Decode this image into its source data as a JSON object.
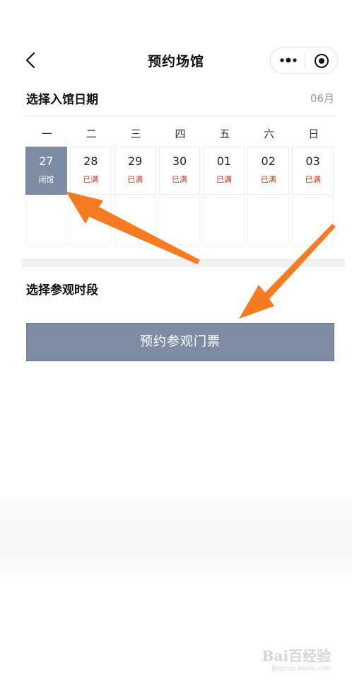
{
  "header": {
    "title": "预约场馆",
    "back_icon": "chevron-left-icon",
    "more_icon": "more-dots-icon",
    "close_icon": "target-close-icon"
  },
  "date_section": {
    "title": "选择入馆日期",
    "month": "06月",
    "weekdays": [
      "一",
      "二",
      "三",
      "四",
      "五",
      "六",
      "日"
    ],
    "days": [
      {
        "day": "27",
        "status": "闭馆",
        "state": "closed"
      },
      {
        "day": "28",
        "status": "已满",
        "state": "full"
      },
      {
        "day": "29",
        "status": "已满",
        "state": "full"
      },
      {
        "day": "30",
        "status": "已满",
        "state": "full"
      },
      {
        "day": "01",
        "status": "已满",
        "state": "full"
      },
      {
        "day": "02",
        "status": "已满",
        "state": "full"
      },
      {
        "day": "03",
        "status": "已满",
        "state": "full"
      }
    ]
  },
  "time_section": {
    "title": "选择参观时段"
  },
  "book_button": {
    "label": "预约参观门票"
  },
  "watermark": {
    "text": "Bai百经验",
    "sub": "jingyan.baidu.com"
  },
  "colors": {
    "accent": "#7d8ca3",
    "full_status": "#c0392b",
    "arrow": "#f57c22"
  }
}
